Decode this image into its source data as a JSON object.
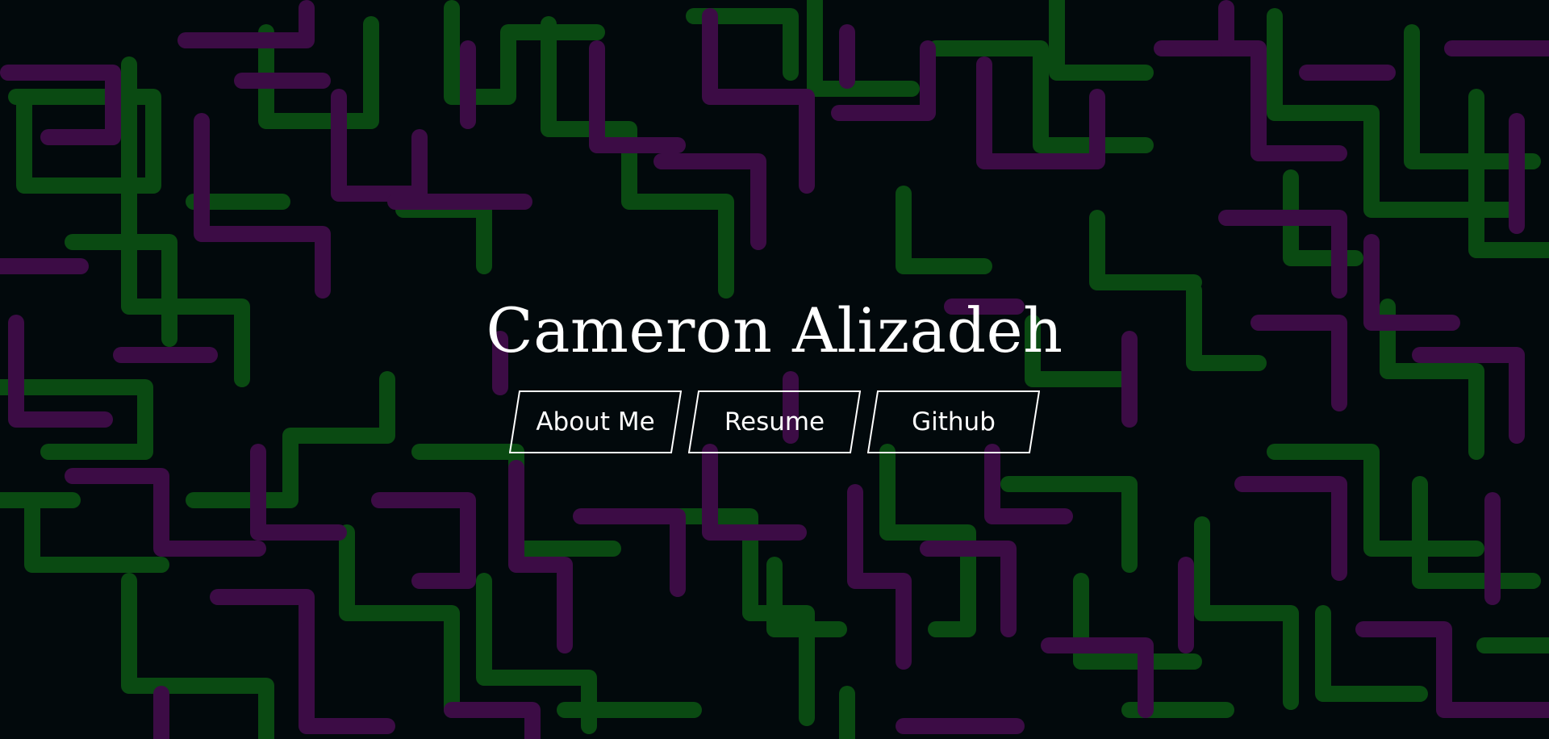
{
  "hero": {
    "title": "Cameron Alizadeh"
  },
  "nav": {
    "items": [
      {
        "label": "About Me"
      },
      {
        "label": "Resume"
      },
      {
        "label": "Github"
      }
    ]
  },
  "colors": {
    "background": "#02090c",
    "green_lines": "#0a4a12",
    "purple_lines": "#3c0c45",
    "text": "#ffffff",
    "button_border": "#ffffff"
  }
}
